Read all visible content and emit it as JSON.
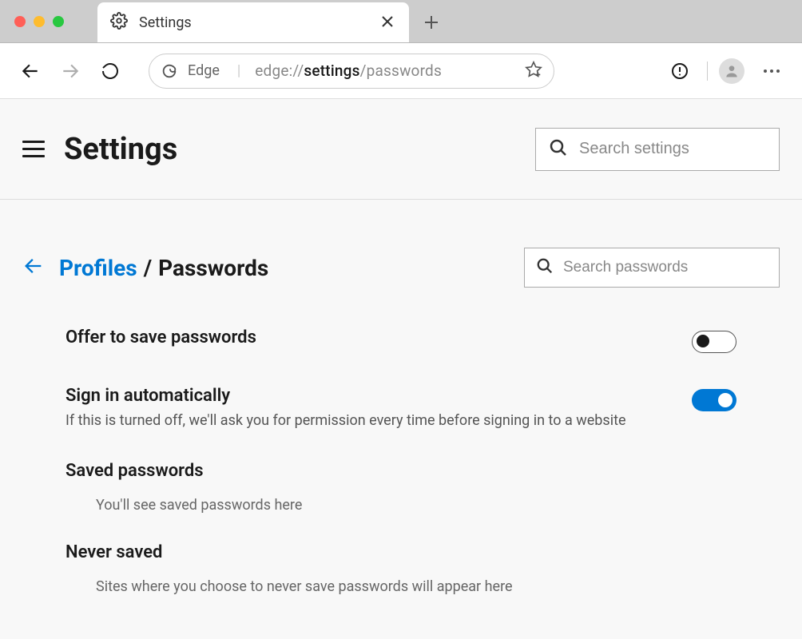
{
  "window": {
    "tab_title": "Settings"
  },
  "toolbar": {
    "brand": "Edge",
    "url_scheme": "edge://",
    "url_path_bold": "settings",
    "url_path_rest": "/passwords"
  },
  "header": {
    "title": "Settings",
    "search_placeholder": "Search settings"
  },
  "breadcrumb": {
    "parent": "Profiles",
    "separator": "/",
    "current": "Passwords",
    "search_placeholder": "Search passwords"
  },
  "settings": {
    "offer_save": {
      "title": "Offer to save passwords",
      "enabled": false
    },
    "auto_signin": {
      "title": "Sign in automatically",
      "desc": "If this is turned off, we'll ask you for permission every time before signing in to a website",
      "enabled": true
    }
  },
  "sections": {
    "saved": {
      "title": "Saved passwords",
      "empty": "You'll see saved passwords here"
    },
    "never": {
      "title": "Never saved",
      "empty": "Sites where you choose to never save passwords will appear here"
    }
  }
}
